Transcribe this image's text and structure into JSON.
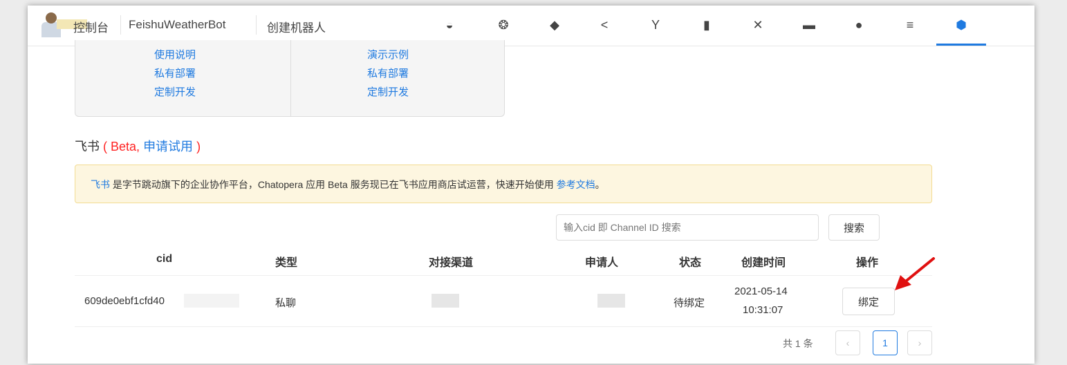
{
  "header": {
    "crumbs": [
      "控制台",
      "FeishuWeatherBot",
      "创建机器人"
    ],
    "crumb_first_prefix_hidden": true,
    "nav_icons": [
      {
        "name": "dashboard-gauge-icon",
        "glyph": "◒"
      },
      {
        "name": "palette-icon",
        "glyph": "❂"
      },
      {
        "name": "graduation-cap-icon",
        "glyph": "◆"
      },
      {
        "name": "share-icon",
        "glyph": "<"
      },
      {
        "name": "branch-icon",
        "glyph": "Y"
      },
      {
        "name": "microphone-icon",
        "glyph": "▮"
      },
      {
        "name": "tools-icon",
        "glyph": "✕"
      },
      {
        "name": "chat-icon",
        "glyph": "▬"
      },
      {
        "name": "record-icon",
        "glyph": "●"
      },
      {
        "name": "sliders-icon",
        "glyph": "≡"
      },
      {
        "name": "cube-icon",
        "glyph": "⬢"
      }
    ],
    "active_color": "#1f7ae0"
  },
  "box": {
    "left_links": [
      "使用说明",
      "私有部署",
      "定制开发"
    ],
    "right_links": [
      "演示示例",
      "私有部署",
      "定制开发"
    ]
  },
  "section": {
    "title_prefix": "飞书",
    "title_open": "( Beta,",
    "title_link": "申请试用",
    "title_close": ")"
  },
  "notice": {
    "link1": "飞书",
    "text": " 是字节跳动旗下的企业协作平台，Chatopera 应用 Beta 服务现已在飞书应用商店试运营，快速开始使用 ",
    "link2": "参考文档",
    "end": "。"
  },
  "search": {
    "placeholder": "输入cid 即 Channel ID 搜索",
    "button": "搜索"
  },
  "table": {
    "headers": [
      "cid",
      "类型",
      "对接渠道",
      "申请人",
      "状态",
      "创建时间",
      "操作"
    ],
    "rows": [
      {
        "cid": "609de0ebf1cfd40",
        "type": "私聊",
        "status": "待绑定",
        "date": "2021-05-14",
        "time": "10:31:07",
        "action": "绑定"
      }
    ]
  },
  "pagination": {
    "total": "共 1 条",
    "prev": "‹",
    "current": "1",
    "next": "›"
  },
  "colors": {
    "link": "#1f7ae0",
    "red": "#ff2222",
    "notice_bg": "#fdf6e0",
    "arrow": "#e01010"
  }
}
